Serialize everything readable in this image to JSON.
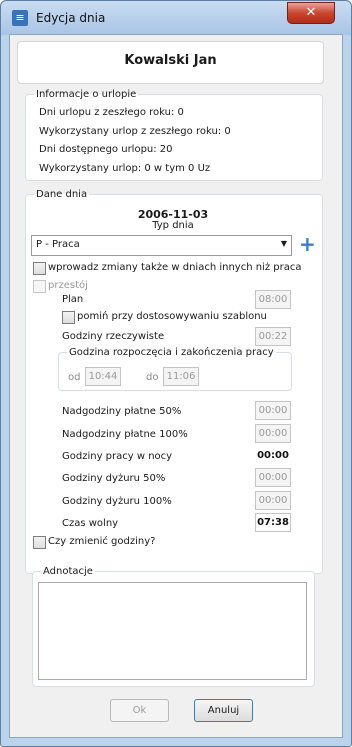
{
  "window": {
    "title": "Edycja dnia",
    "close_label": "✕"
  },
  "employee": {
    "name": "Kowalski Jan"
  },
  "leave": {
    "legend": "Informacje o urlopie",
    "lines": [
      "Dni urlopu z zeszłego roku: 0",
      "Wykorzystany urlop z zeszłego roku: 0",
      "Dni dostępnego urlopu: 20",
      "Wykorzystany urlop: 0 w tym 0 Uz"
    ]
  },
  "day": {
    "legend": "Dane dnia",
    "date": "2006-11-03",
    "type_label": "Typ dnia",
    "type_value": "P - Praca",
    "apply_other_label": "wprowadz zmiany także w dniach innych niż praca",
    "downtime_label": "przestój",
    "plan_label": "Plan",
    "plan_value": "08:00",
    "skip_template_label": "pomiń przy dostosowywaniu szablonu",
    "actual_hours_label": "Godziny rzeczywiste",
    "actual_hours_value": "00:22",
    "range": {
      "legend": "Godzina rozpoczęcia i zakończenia pracy",
      "from_label": "od",
      "from_value": "10:44",
      "to_label": "do",
      "to_value": "11:06"
    },
    "rows": [
      {
        "label": "Nadgodziny płatne 50%",
        "value": "00:00"
      },
      {
        "label": "Nadgodziny płatne 100%",
        "value": "00:00"
      },
      {
        "label": "Godziny pracy w nocy",
        "value": "00:00"
      },
      {
        "label": "Godziny dyżuru 50%",
        "value": "00:00"
      },
      {
        "label": "Godziny dyżuru 100%",
        "value": "00:00"
      },
      {
        "label": "Czas wolny",
        "value": "07:38"
      }
    ],
    "change_hours_label": "Czy zmienić godziny?"
  },
  "notes": {
    "legend": "Adnotacje"
  },
  "buttons": {
    "ok": "Ok",
    "cancel": "Anuluj"
  }
}
